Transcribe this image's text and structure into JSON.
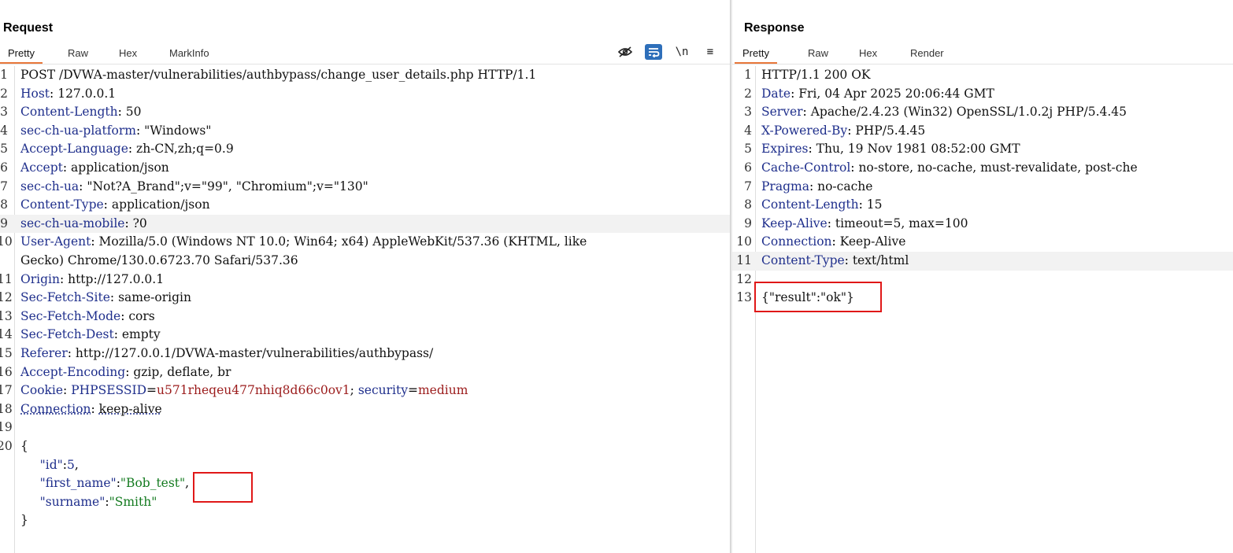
{
  "request": {
    "title": "Request",
    "tabs": [
      "Pretty",
      "Raw",
      "Hex",
      "MarkInfo"
    ],
    "active_tab": "Pretty",
    "toolbar": {
      "wrap_label": "\\n",
      "menu_label": "≡"
    },
    "lines": [
      {
        "n": "1",
        "name": "",
        "value": "POST /DVWA-master/vulnerabilities/authbypass/change_user_details.php HTTP/1.1"
      },
      {
        "n": "2",
        "name": "Host",
        "value": "127.0.0.1"
      },
      {
        "n": "3",
        "name": "Content-Length",
        "value": "50"
      },
      {
        "n": "4",
        "name": "sec-ch-ua-platform",
        "value": "\"Windows\""
      },
      {
        "n": "5",
        "name": "Accept-Language",
        "value": "zh-CN,zh;q=0.9"
      },
      {
        "n": "6",
        "name": "Accept",
        "value": "application/json"
      },
      {
        "n": "7",
        "name": "sec-ch-ua",
        "value": "\"Not?A_Brand\";v=\"99\", \"Chromium\";v=\"130\""
      },
      {
        "n": "8",
        "name": "Content-Type",
        "value": "application/json"
      },
      {
        "n": "9",
        "name": "sec-ch-ua-mobile",
        "value": "?0"
      },
      {
        "n": "10",
        "name": "User-Agent",
        "value": "Mozilla/5.0 (Windows NT 10.0; Win64; x64) AppleWebKit/537.36 (KHTML, like"
      },
      {
        "n": "",
        "name": "",
        "value": "Gecko) Chrome/130.0.6723.70 Safari/537.36"
      },
      {
        "n": "11",
        "name": "Origin",
        "value": "http://127.0.0.1"
      },
      {
        "n": "12",
        "name": "Sec-Fetch-Site",
        "value": "same-origin"
      },
      {
        "n": "13",
        "name": "Sec-Fetch-Mode",
        "value": "cors"
      },
      {
        "n": "14",
        "name": "Sec-Fetch-Dest",
        "value": "empty"
      },
      {
        "n": "15",
        "name": "Referer",
        "value": "http://127.0.0.1/DVWA-master/vulnerabilities/authbypass/"
      },
      {
        "n": "16",
        "name": "Accept-Encoding",
        "value": "gzip, deflate, br"
      },
      {
        "n": "17",
        "name": "Cookie",
        "value": ""
      },
      {
        "n": "18",
        "name": "Connection",
        "value": "keep-alive"
      },
      {
        "n": "19",
        "name": "",
        "value": ""
      },
      {
        "n": "20",
        "name": "",
        "value": "{"
      },
      {
        "n": "",
        "name": "",
        "value": ""
      },
      {
        "n": "",
        "name": "",
        "value": ""
      },
      {
        "n": "",
        "name": "",
        "value": ""
      },
      {
        "n": "",
        "name": "",
        "value": "}"
      }
    ],
    "cookie": {
      "n1": "PHPSESSID",
      "v1": "u571rheqeu477nhiq8d66c0ov1",
      "sep": "; ",
      "n2": "security",
      "v2": "medium"
    },
    "body": {
      "id_key": "\"id\"",
      "id_val": "5",
      "fn_key": "\"first_name\"",
      "fn_val": "\"Bob_test\"",
      "sn_key": "\"surname\"",
      "sn_val": "\"Smith\""
    }
  },
  "response": {
    "title": "Response",
    "tabs": [
      "Pretty",
      "Raw",
      "Hex",
      "Render"
    ],
    "active_tab": "Pretty",
    "lines": [
      {
        "n": "1",
        "name": "",
        "value": "HTTP/1.1 200 OK"
      },
      {
        "n": "2",
        "name": "Date",
        "value": "Fri, 04 Apr 2025 20:06:44 GMT"
      },
      {
        "n": "3",
        "name": "Server",
        "value": "Apache/2.4.23 (Win32) OpenSSL/1.0.2j PHP/5.4.45"
      },
      {
        "n": "4",
        "name": "X-Powered-By",
        "value": "PHP/5.4.45"
      },
      {
        "n": "5",
        "name": "Expires",
        "value": "Thu, 19 Nov 1981 08:52:00 GMT"
      },
      {
        "n": "6",
        "name": "Cache-Control",
        "value": "no-store, no-cache, must-revalidate, post-che"
      },
      {
        "n": "7",
        "name": "Pragma",
        "value": "no-cache"
      },
      {
        "n": "8",
        "name": "Content-Length",
        "value": "15"
      },
      {
        "n": "9",
        "name": "Keep-Alive",
        "value": "timeout=5, max=100"
      },
      {
        "n": "10",
        "name": "Connection",
        "value": "Keep-Alive"
      },
      {
        "n": "11",
        "name": "Content-Type",
        "value": "text/html"
      },
      {
        "n": "12",
        "name": "",
        "value": ""
      },
      {
        "n": "13",
        "name": "",
        "value": "{\"result\":\"ok\"}"
      }
    ]
  }
}
